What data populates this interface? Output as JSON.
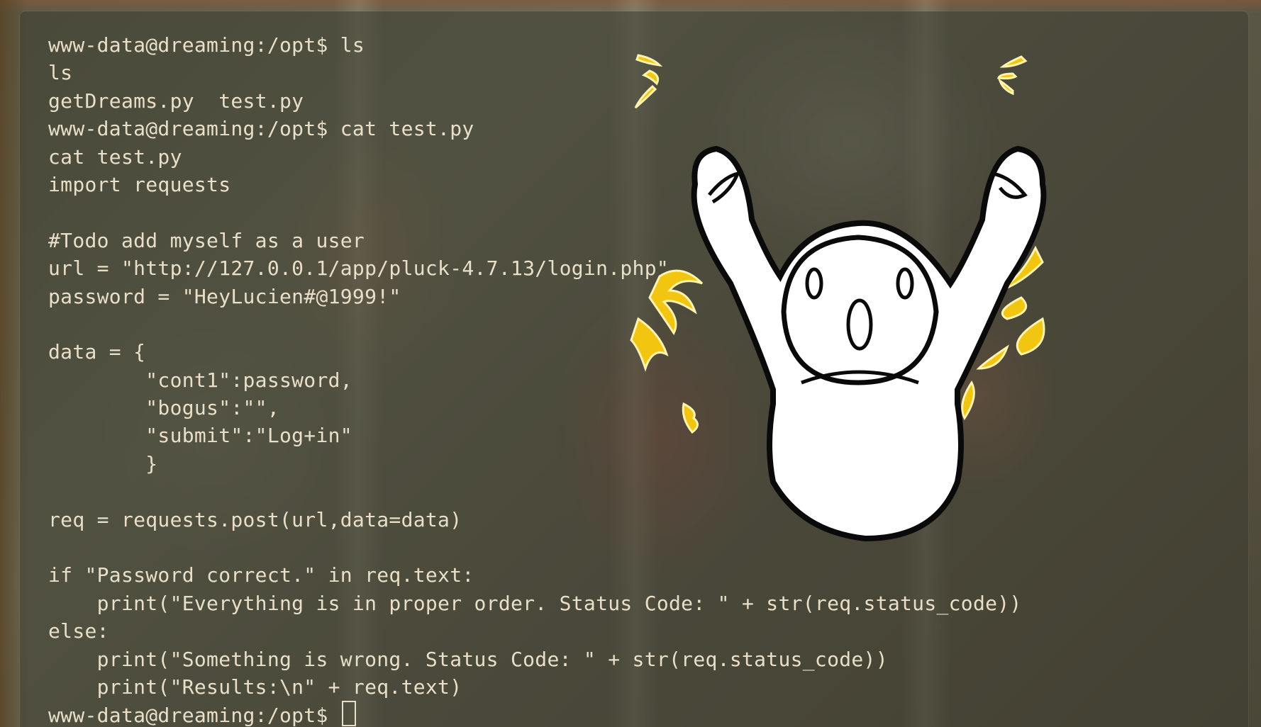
{
  "terminal": {
    "prompt": "www-data@dreaming:/opt$",
    "lines": [
      "www-data@dreaming:/opt$ ls",
      "ls",
      "getDreams.py  test.py",
      "www-data@dreaming:/opt$ cat test.py",
      "cat test.py",
      "import requests",
      "",
      "#Todo add myself as a user",
      "url = \"http://127.0.0.1/app/pluck-4.7.13/login.php\"",
      "password = \"HeyLucien#@1999!\"",
      "",
      "data = {",
      "        \"cont1\":password,",
      "        \"bogus\":\"\",",
      "        \"submit\":\"Log+in\"",
      "        }",
      "",
      "req = requests.post(url,data=data)",
      "",
      "if \"Password correct.\" in req.text:",
      "    print(\"Everything is in proper order. Status Code: \" + str(req.status_code))",
      "else:",
      "    print(\"Something is wrong. Status Code: \" + str(req.status_code))",
      "    print(\"Results:\\n\" + req.text)"
    ],
    "current_prompt": "www-data@dreaming:/opt$ "
  },
  "sticker": {
    "icon": "cheering-ghost-icon"
  },
  "colors": {
    "terminal_text": "#e9dfc9",
    "terminal_bg": "rgba(60,60,48,0.55)",
    "accent_yellow": "#f2c511"
  }
}
